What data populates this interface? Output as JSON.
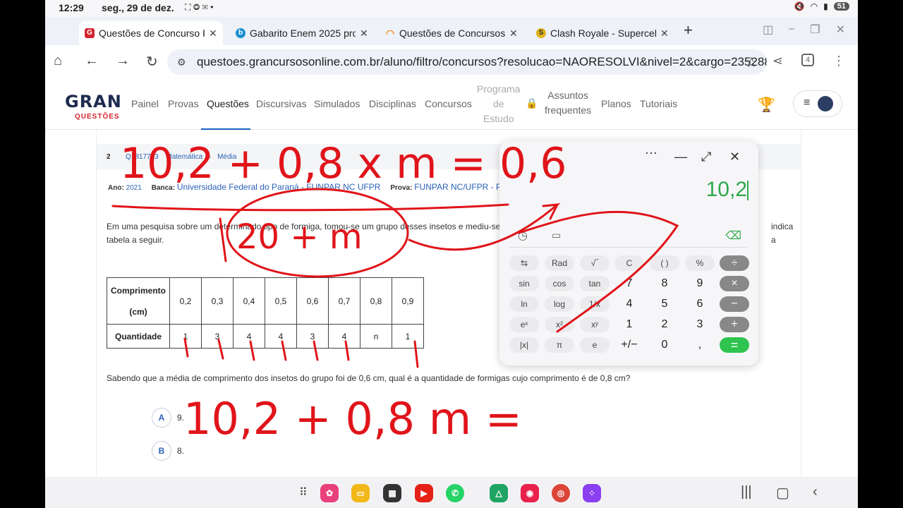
{
  "status": {
    "time": "12:29",
    "date": "seg., 29 de dez.",
    "battery": "51"
  },
  "tabs": [
    {
      "title": "Questões de Concurso P",
      "color": "#d3242d"
    },
    {
      "title": "Gabarito Enem 2025 prov",
      "color": "#1a8fd0"
    },
    {
      "title": "Questões de Concursos",
      "color": "#f28c1c"
    },
    {
      "title": "Clash Royale - Supercell",
      "color": "#e3b21a"
    }
  ],
  "address": {
    "url": "questoes.grancursosonline.com.br/aluno/filtro/concursos?resolucao=NAORESOLVI&nivel=2&cargo=235288",
    "tab_count": "4"
  },
  "site": {
    "logo_main": "GRAN",
    "logo_sub": "QUESTÕES",
    "nav": [
      "Painel",
      "Provas",
      "Questões",
      "Discursivas",
      "Simulados",
      "Disciplinas",
      "Concursos"
    ],
    "nav_programa": [
      "Programa",
      "de",
      "Estudo"
    ],
    "nav_assuntos": [
      "Assuntos",
      "frequentes"
    ],
    "nav_planos": "Planos",
    "nav_tutoriais": "Tutoriais"
  },
  "question": {
    "number": "2",
    "code": "Q1817703",
    "subject": "Matemática",
    "topic": "Média",
    "ano_label": "Ano:",
    "ano": "2021",
    "banca_label": "Banca:",
    "banca": "Universidade Federal do Paraná - FUNPAR NC UFPR",
    "prova_label": "Prova:",
    "prova": "FUNPAR NC/UFPR - PM PR - S",
    "statement_line1": "Em uma pesquisa sobre um determinado tipo de formiga, tomou-se um grupo desses insetos e mediu-se",
    "statement_tail": "indica a",
    "statement_line2": "tabela a seguir.",
    "table": {
      "row1_label_a": "Comprimento",
      "row1_label_b": "(cm)",
      "row1": [
        "0,2",
        "0,3",
        "0,4",
        "0,5",
        "0,6",
        "0,7",
        "0,8",
        "0,9"
      ],
      "row2_label": "Quantidade",
      "row2": [
        "1",
        "3",
        "4",
        "4",
        "3",
        "4",
        "n",
        "1"
      ]
    },
    "ask": "Sabendo que a média de comprimento dos insetos do grupo foi de 0,6 cm, qual é a quantidade de formigas cujo comprimento é de 0,8 cm?",
    "options": [
      {
        "letter": "A",
        "text": "9."
      },
      {
        "letter": "B",
        "text": "8."
      }
    ]
  },
  "calculator": {
    "display": "10,2",
    "rows": [
      [
        "⇆",
        "Rad",
        "√‾",
        "C",
        "( )",
        "%",
        "÷"
      ],
      [
        "sin",
        "cos",
        "tan",
        "7",
        "8",
        "9",
        "×"
      ],
      [
        "ln",
        "log",
        "1/x",
        "4",
        "5",
        "6",
        "−"
      ],
      [
        "eˣ",
        "x²",
        "xʸ",
        "1",
        "2",
        "3",
        "+"
      ],
      [
        "|x|",
        "π",
        "e",
        "+/−",
        "0",
        ",",
        "="
      ]
    ]
  },
  "annotations": {
    "top": "10,2 + 0,8 x m = 0,6",
    "circled": "20 + m",
    "bottom": "10,2 + 0,8 m ="
  }
}
